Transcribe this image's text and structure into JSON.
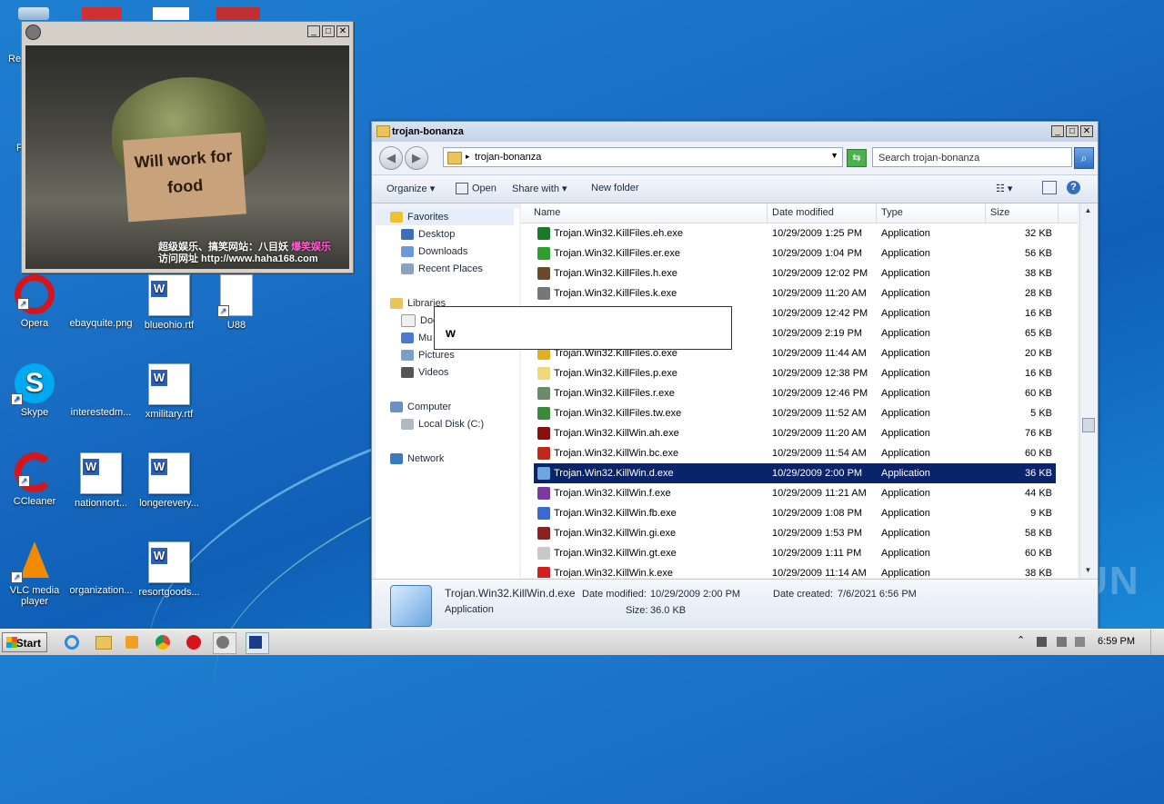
{
  "desktop": {
    "icons": [
      {
        "label": "Opera",
        "shortcut": true
      },
      {
        "label": "ebayquite.png"
      },
      {
        "label": "blueohio.rtf"
      },
      {
        "label": "U88"
      },
      {
        "label": "Skype",
        "shortcut": true
      },
      {
        "label": "interestedm..."
      },
      {
        "label": "xmilitary.rtf"
      },
      {
        "label": "CCleaner",
        "shortcut": true
      },
      {
        "label": "nationnort..."
      },
      {
        "label": "longerevery..."
      },
      {
        "label": "VLC media player",
        "shortcut": true
      },
      {
        "label": "organization..."
      },
      {
        "label": "resortgoods..."
      }
    ],
    "partial_labels": [
      "Re",
      "F"
    ],
    "watermark": "ANY RUN"
  },
  "image_viewer": {
    "sign_text": "Will work for food",
    "caption_line1": "超级娱乐、搞笑网站：八目妖",
    "caption_highlight": "爆笑娱乐",
    "caption_line2": "访问网址  http://www.haha168.com"
  },
  "explorer": {
    "title": "trojan-bonanza",
    "address": "trojan-bonanza",
    "search_placeholder": "Search trojan-bonanza",
    "toolbar": {
      "organize": "Organize",
      "open": "Open",
      "share_with": "Share with",
      "new_folder": "New folder"
    },
    "nav": {
      "favorites": "Favorites",
      "desktop": "Desktop",
      "downloads": "Downloads",
      "recent_places": "Recent Places",
      "libraries": "Libraries",
      "documents": "Doc",
      "music": "Mu",
      "pictures": "Pictures",
      "videos": "Videos",
      "computer": "Computer",
      "local_disk": "Local Disk (C:)",
      "network": "Network"
    },
    "columns": {
      "name": "Name",
      "date": "Date modified",
      "type": "Type",
      "size": "Size"
    },
    "files": [
      {
        "name": "Trojan.Win32.KillFiles.eh.exe",
        "date": "10/29/2009 1:25 PM",
        "type": "Application",
        "size": "32 KB",
        "color": "#1b7a2a"
      },
      {
        "name": "Trojan.Win32.KillFiles.er.exe",
        "date": "10/29/2009 1:04 PM",
        "type": "Application",
        "size": "56 KB",
        "color": "#2e9e2e"
      },
      {
        "name": "Trojan.Win32.KillFiles.h.exe",
        "date": "10/29/2009 12:02 PM",
        "type": "Application",
        "size": "38 KB",
        "color": "#6b4a2a"
      },
      {
        "name": "Trojan.Win32.KillFiles.k.exe",
        "date": "10/29/2009 11:20 AM",
        "type": "Application",
        "size": "28 KB",
        "color": "#777777"
      },
      {
        "name": "",
        "date": "10/29/2009 12:42 PM",
        "type": "Application",
        "size": "16 KB",
        "color": "#c62828"
      },
      {
        "name": "",
        "date": "10/29/2009 2:19 PM",
        "type": "Application",
        "size": "65 KB",
        "color": "#555555"
      },
      {
        "name": "Trojan.Win32.KillFiles.o.exe",
        "date": "10/29/2009 11:44 AM",
        "type": "Application",
        "size": "20 KB",
        "color": "#e0b020"
      },
      {
        "name": "Trojan.Win32.KillFiles.p.exe",
        "date": "10/29/2009 12:38 PM",
        "type": "Application",
        "size": "16 KB",
        "color": "#f0d878"
      },
      {
        "name": "Trojan.Win32.KillFiles.r.exe",
        "date": "10/29/2009 12:46 PM",
        "type": "Application",
        "size": "60 KB",
        "color": "#6a8a6a"
      },
      {
        "name": "Trojan.Win32.KillFiles.tw.exe",
        "date": "10/29/2009 11:52 AM",
        "type": "Application",
        "size": "5 KB",
        "color": "#3a8a3a"
      },
      {
        "name": "Trojan.Win32.KillWin.ah.exe",
        "date": "10/29/2009 11:20 AM",
        "type": "Application",
        "size": "76 KB",
        "color": "#8a1010"
      },
      {
        "name": "Trojan.Win32.KillWin.bc.exe",
        "date": "10/29/2009 11:54 AM",
        "type": "Application",
        "size": "60 KB",
        "color": "#c0281a"
      },
      {
        "name": "Trojan.Win32.KillWin.d.exe",
        "date": "10/29/2009 2:00 PM",
        "type": "Application",
        "size": "36 KB",
        "color": "#6aa6e0",
        "selected": true
      },
      {
        "name": "Trojan.Win32.KillWin.f.exe",
        "date": "10/29/2009 11:21 AM",
        "type": "Application",
        "size": "44 KB",
        "color": "#7a3aa0"
      },
      {
        "name": "Trojan.Win32.KillWin.fb.exe",
        "date": "10/29/2009 1:08 PM",
        "type": "Application",
        "size": "9 KB",
        "color": "#3a6ad0"
      },
      {
        "name": "Trojan.Win32.KillWin.gi.exe",
        "date": "10/29/2009 1:53 PM",
        "type": "Application",
        "size": "58 KB",
        "color": "#8a2020"
      },
      {
        "name": "Trojan.Win32.KillWin.gt.exe",
        "date": "10/29/2009 1:11 PM",
        "type": "Application",
        "size": "60 KB",
        "color": "#c8c8c8"
      },
      {
        "name": "Trojan.Win32.KillWin.k.exe",
        "date": "10/29/2009 11:14 AM",
        "type": "Application",
        "size": "38 KB",
        "color": "#d02020"
      }
    ],
    "details": {
      "name": "Trojan.Win32.KillWin.d.exe",
      "type": "Application",
      "date_modified_label": "Date modified:",
      "date_modified": "10/29/2009 2:00 PM",
      "date_created_label": "Date created:",
      "date_created": "7/6/2021 6:56 PM",
      "size_label": "Size:",
      "size": "36.0 KB"
    }
  },
  "tooltip": {
    "text": "w"
  },
  "taskbar": {
    "start": "Start",
    "clock": "6:59 PM"
  }
}
